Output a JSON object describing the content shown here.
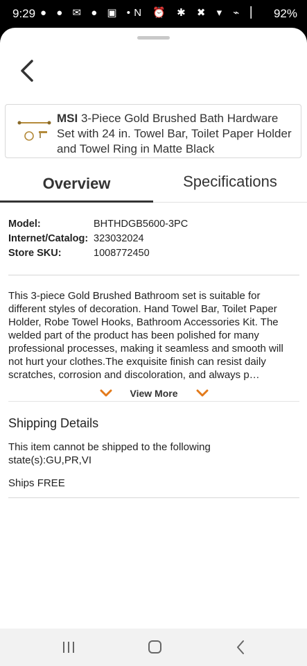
{
  "status_bar": {
    "time": "9:29",
    "left_icons": "● ● ✉ ● ▣ •",
    "right_icons": "N ⏰ ✱ ✖ ▾ ⌁ ▏",
    "battery": "92%"
  },
  "product": {
    "brand": "MSI",
    "title": " 3-Piece Gold Brushed Bath Hardware Set with 24 in. Towel Bar, Toilet Paper Holder and Towel Ring in Matte Black"
  },
  "tabs": {
    "overview": "Overview",
    "specifications": "Specifications",
    "active": "overview"
  },
  "specs": [
    {
      "label": "Model:",
      "value": "BHTHDGB5600-3PC"
    },
    {
      "label": "Internet/Catalog:",
      "value": "323032024"
    },
    {
      "label": "Store SKU:",
      "value": "1008772450"
    }
  ],
  "description": "This 3-piece Gold Brushed Bathroom set is suitable for different styles of decoration. Hand Towel Bar, Toilet Paper Holder, Robe Towel Hooks, Bathroom Accessories Kit. The welded part of the product has been polished for many professional processes, making it seamless and smooth will not hurt your clothes.The exquisite finish can resist daily scratches, corrosion and discoloration, and always p…",
  "view_more": "View More",
  "shipping": {
    "title": "Shipping Details",
    "restriction": "This item cannot be shipped to the following state(s):GU,PR,VI",
    "ships_free": "Ships FREE"
  },
  "colors": {
    "accent_orange": "#E37A1B",
    "text_dark": "#222222"
  },
  "icons": {
    "back": "chevron-left-icon",
    "view_more": "chevron-down-icon",
    "nav_recent": "recent-apps-icon",
    "nav_home": "home-icon",
    "nav_back": "back-icon"
  }
}
